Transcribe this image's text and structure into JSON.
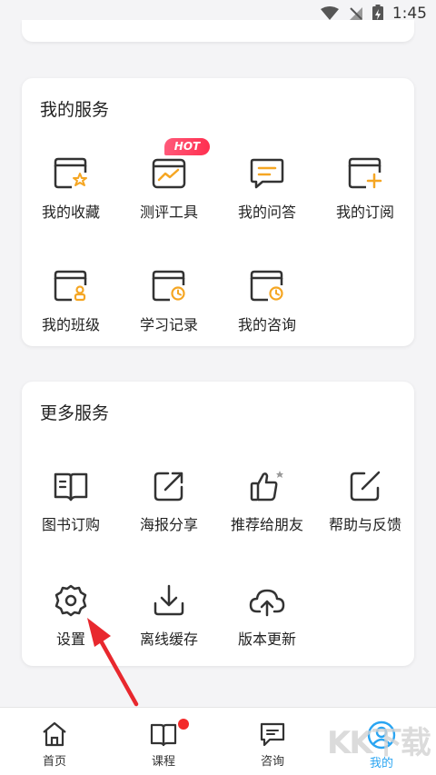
{
  "status_bar": {
    "time": "1:45"
  },
  "my_services": {
    "title": "我的服务",
    "hot_badge": "HOT",
    "items": [
      {
        "label": "我的收藏",
        "icon": "folder-star-icon"
      },
      {
        "label": "测评工具",
        "icon": "chart-trend-icon"
      },
      {
        "label": "我的问答",
        "icon": "chat-lines-icon"
      },
      {
        "label": "我的订阅",
        "icon": "folder-plus-icon"
      },
      {
        "label": "我的班级",
        "icon": "folder-person-icon"
      },
      {
        "label": "学习记录",
        "icon": "folder-clock-icon"
      },
      {
        "label": "我的咨询",
        "icon": "folder-clock-icon"
      }
    ]
  },
  "more_services": {
    "title": "更多服务",
    "items": [
      {
        "label": "图书订购",
        "icon": "book-icon"
      },
      {
        "label": "海报分享",
        "icon": "share-arrow-icon"
      },
      {
        "label": "推荐给朋友",
        "icon": "thumbs-up-icon"
      },
      {
        "label": "帮助与反馈",
        "icon": "edit-icon"
      },
      {
        "label": "设置",
        "icon": "gear-icon"
      },
      {
        "label": "离线缓存",
        "icon": "download-icon"
      },
      {
        "label": "版本更新",
        "icon": "cloud-upload-icon"
      }
    ]
  },
  "tab_bar": {
    "active": "我的",
    "tabs": [
      {
        "label": "首页",
        "icon": "home-icon"
      },
      {
        "label": "课程",
        "icon": "book-open-icon"
      },
      {
        "label": "咨询",
        "icon": "chat-icon"
      },
      {
        "label": "我的",
        "icon": "user-icon"
      }
    ]
  },
  "colors": {
    "accent_orange": "#f5a623",
    "active_blue": "#2aa5f2",
    "hot_red": "#ff2f4f",
    "arrow_red": "#e8282e"
  },
  "watermark": "KK下载"
}
